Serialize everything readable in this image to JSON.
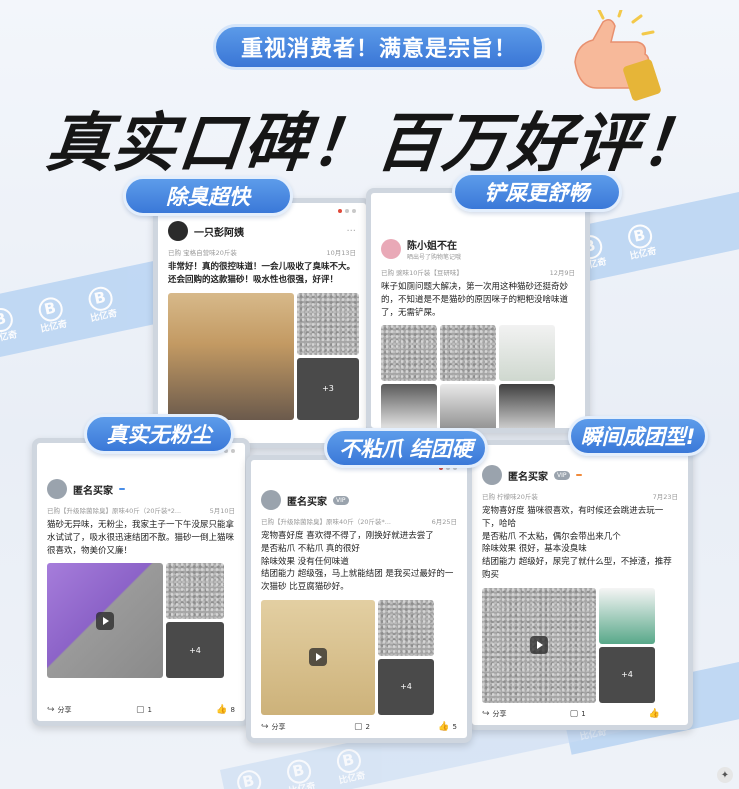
{
  "header": {
    "slogan": "重视消费者！满意是宗旨！",
    "headline": "真实口碑！百万好评！"
  },
  "watermark": {
    "logo": "B",
    "brand": "比亿奇"
  },
  "tags": {
    "t1": "除臭超快",
    "t2": "铲屎更舒畅",
    "t3": "真实无粉尘",
    "t4": "不粘爪 结团硬",
    "t5": "瞬间成团型!"
  },
  "colors": {
    "accent": "#3a78d8",
    "ribbon": "#b9d4f3"
  },
  "cards": {
    "c1": {
      "user": "一只彭阿姨",
      "meta": "已购 宝格自营味20斤装",
      "date": "10月13日",
      "review": "非常好！真的很控味道！一会儿吸收了臭味不大。还会回购的这款猫砂！吸水性也很强，好评！",
      "extra_count": "+3"
    },
    "c2": {
      "user": "陈小姐不在",
      "sub": "晒出号了购物笔记哦",
      "meta": "已购 豌味10斤装【豆研味】",
      "date": "12月9日",
      "review": "咪子如厕问题大解决，第一次用这种猫砂还挺奇妙的，不知道是不是猫砂的原因咪子的粑粑没啥味道了，无需铲屎。"
    },
    "c3": {
      "user": "匿名买家",
      "meta": "已购【升级除菌除臭】原味40斤（20斤装*2...",
      "date": "5月10日",
      "review": "猫砂无异味，无粉尘，我家主子一下午没尿只能拿水试试了，吸水很迅速结团不散。猫砂一倒上猫咪很喜欢，物美价又廉！",
      "extra_count": "+4",
      "share": "分享",
      "comments": "1",
      "likes": "8"
    },
    "c4": {
      "user": "匿名买家",
      "badge": "VIP",
      "meta": "已购【升级除菌除臭】原味40斤（20斤装*...",
      "date": "6月25日",
      "lines": [
        "宠物喜好度 喜欢得不得了，刚换好就进去尝了",
        "是否粘爪 不粘爪 真的很好",
        "除味效果 没有任何味道",
        "结团能力 超级强，马上就能结团 是我买过最好的一次猫砂 比豆腐猫砂好。"
      ],
      "extra_count": "+4",
      "share": "分享",
      "comments": "2",
      "likes": "5"
    },
    "c5": {
      "user": "匿名买家",
      "badge": "VIP",
      "meta": "已购 柠檬味20斤装",
      "date": "7月23日",
      "lines": [
        "宠物喜好度 猫咪很喜欢，有时候还会跳进去玩一下，哈哈",
        "是否粘爪 不太粘，偶尔会带出来几个",
        "除味效果 很好，基本没臭味",
        "结团能力 超级好，尿完了就什么型，不掉渣，推荐购买"
      ],
      "extra_count": "+4",
      "share": "分享",
      "comments": "1"
    }
  }
}
